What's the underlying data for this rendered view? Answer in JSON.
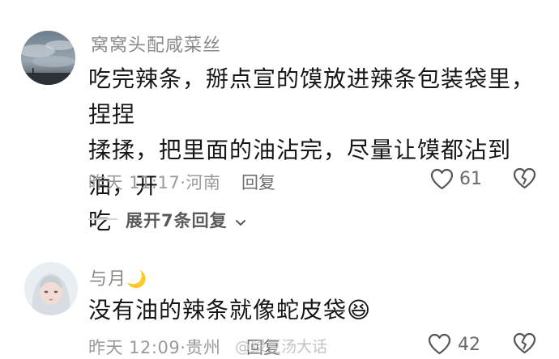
{
  "comments": [
    {
      "username": "窝窝头配咸菜丝",
      "content_lines": [
        "吃完辣条，掰点宣的馍放进辣条包装袋里，捏捏",
        "揉揉，把里面的油沾完，尽量让馍都沾到油，开",
        "吃"
      ],
      "time": "昨天 11:17",
      "location": "河南",
      "reply_label": "回复",
      "likes": "61"
    },
    {
      "username": "与月",
      "username_emoji": "🌙",
      "content": "没有油的辣条就像蛇皮袋",
      "content_emoji": "😆",
      "time": "昨天 12:09",
      "location": "贵州",
      "reply_label": "回复",
      "likes": "42"
    }
  ],
  "expand_replies": {
    "label": "展开7条回复"
  },
  "watermark": "@绿豆汤大话",
  "icons": {
    "like": "heart-outline-icon",
    "dislike": "broken-heart-icon",
    "expand": "chevron-down-icon"
  },
  "colors": {
    "text": "#161616",
    "muted": "#9a9a9a",
    "icon": "#555555"
  }
}
